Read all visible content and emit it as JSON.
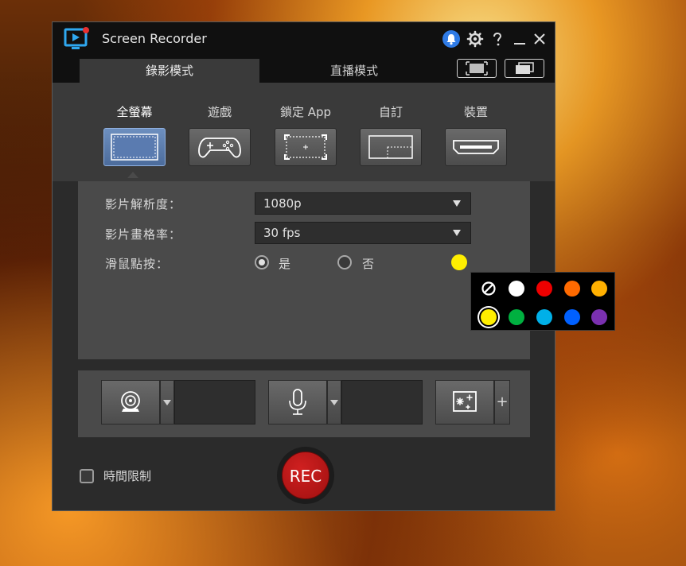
{
  "window": {
    "title": "Screen Recorder"
  },
  "tabs": [
    {
      "label": "錄影模式"
    },
    {
      "label": "直播模式"
    }
  ],
  "modes": [
    {
      "label": "全螢幕"
    },
    {
      "label": "遊戲"
    },
    {
      "label": "鎖定 App"
    },
    {
      "label": "自訂"
    },
    {
      "label": "裝置"
    }
  ],
  "settings": {
    "resolution_label": "影片解析度：",
    "resolution_value": "1080p",
    "framerate_label": "影片畫格率：",
    "framerate_value": "30 fps",
    "mouse_click_label": "滑鼠點按：",
    "yes_label": "是",
    "no_label": "否",
    "click_color": "#ffee00"
  },
  "palette": {
    "colors": [
      "none",
      "#ffffff",
      "#ee0000",
      "#ff6a00",
      "#ffb000",
      "#ffee00",
      "#00b040",
      "#00b0e8",
      "#0060ff",
      "#7a30b0"
    ],
    "selected": "#ffee00"
  },
  "bottom": {
    "time_limit_label": "時間限制",
    "rec_label": "REC"
  },
  "title_icons": [
    "notification-icon",
    "gear-icon",
    "help-icon",
    "minimize-icon",
    "close-icon"
  ],
  "plus_label": "+"
}
